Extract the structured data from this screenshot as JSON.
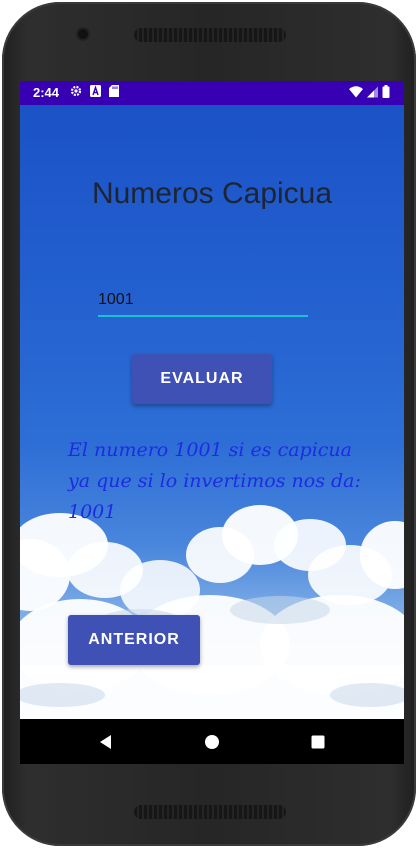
{
  "status_bar": {
    "time": "2:44",
    "color": "#3700b3",
    "left_icons": [
      "settings-icon",
      "a-icon",
      "sd-card-icon"
    ],
    "right_icons": [
      "wifi-icon",
      "signal-icon",
      "battery-icon"
    ]
  },
  "app": {
    "title": "Numeros Capicua",
    "input": {
      "value": "1001",
      "underline_color": "#19c3d6"
    },
    "evaluate_button": "EVALUAR",
    "result_text": "El numero 1001 si es capicua ya que si lo invertimos nos da: 1001",
    "back_button": "ANTERIOR",
    "button_color": "#3f51b5",
    "result_color": "#1d2ce0"
  },
  "nav_bar": {
    "icons": [
      "back-icon",
      "home-icon",
      "recents-icon"
    ]
  }
}
